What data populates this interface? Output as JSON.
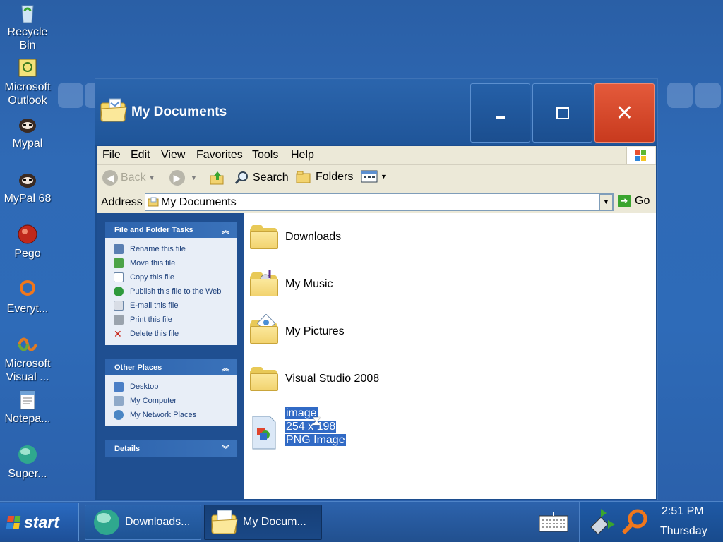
{
  "desktop": {
    "icons": [
      {
        "label": "Recycle Bin"
      },
      {
        "label": "Microsoft Outlook"
      },
      {
        "label": "Mypal"
      },
      {
        "label": "MyPal 68"
      },
      {
        "label": "Pego"
      },
      {
        "label": "Everyt..."
      },
      {
        "label": "Microsoft Visual ..."
      },
      {
        "label": "Notepa..."
      },
      {
        "label": "Super..."
      }
    ]
  },
  "window": {
    "title": "My Documents",
    "controls": {
      "minimize": "-",
      "maximize": "□",
      "close": "✕"
    }
  },
  "menubar": {
    "items": [
      "File",
      "Edit",
      "View",
      "Favorites",
      "Tools",
      "Help"
    ]
  },
  "toolbar": {
    "back": "Back",
    "search": "Search",
    "folders": "Folders"
  },
  "address": {
    "label": "Address",
    "value": "My Documents",
    "go": "Go"
  },
  "tasks": {
    "file_folder": {
      "title": "File and Folder Tasks",
      "links": [
        "Rename this file",
        "Move this file",
        "Copy this file",
        "Publish this file to the Web",
        "E-mail this file",
        "Print this file",
        "Delete this file"
      ]
    },
    "other_places": {
      "title": "Other Places",
      "links": [
        "Desktop",
        "My Computer",
        "My Network Places"
      ]
    },
    "details": {
      "title": "Details"
    }
  },
  "content": {
    "items": [
      {
        "name": "Downloads",
        "type": "folder"
      },
      {
        "name": "My Music",
        "type": "music-folder"
      },
      {
        "name": "My Pictures",
        "type": "pictures-folder"
      },
      {
        "name": "Visual Studio 2008",
        "type": "folder"
      }
    ],
    "selected_file": {
      "name": "image",
      "dimensions": "254 x 198",
      "type": "PNG Image"
    }
  },
  "taskbar": {
    "start": "start",
    "buttons": [
      "Downloads...",
      "My Docum..."
    ],
    "clock_time": "2:51 PM",
    "clock_day": "Thursday"
  },
  "colors": {
    "selection": "#316ac5",
    "close_button": "#d94a2b",
    "task_pane": "#1f4f91"
  }
}
